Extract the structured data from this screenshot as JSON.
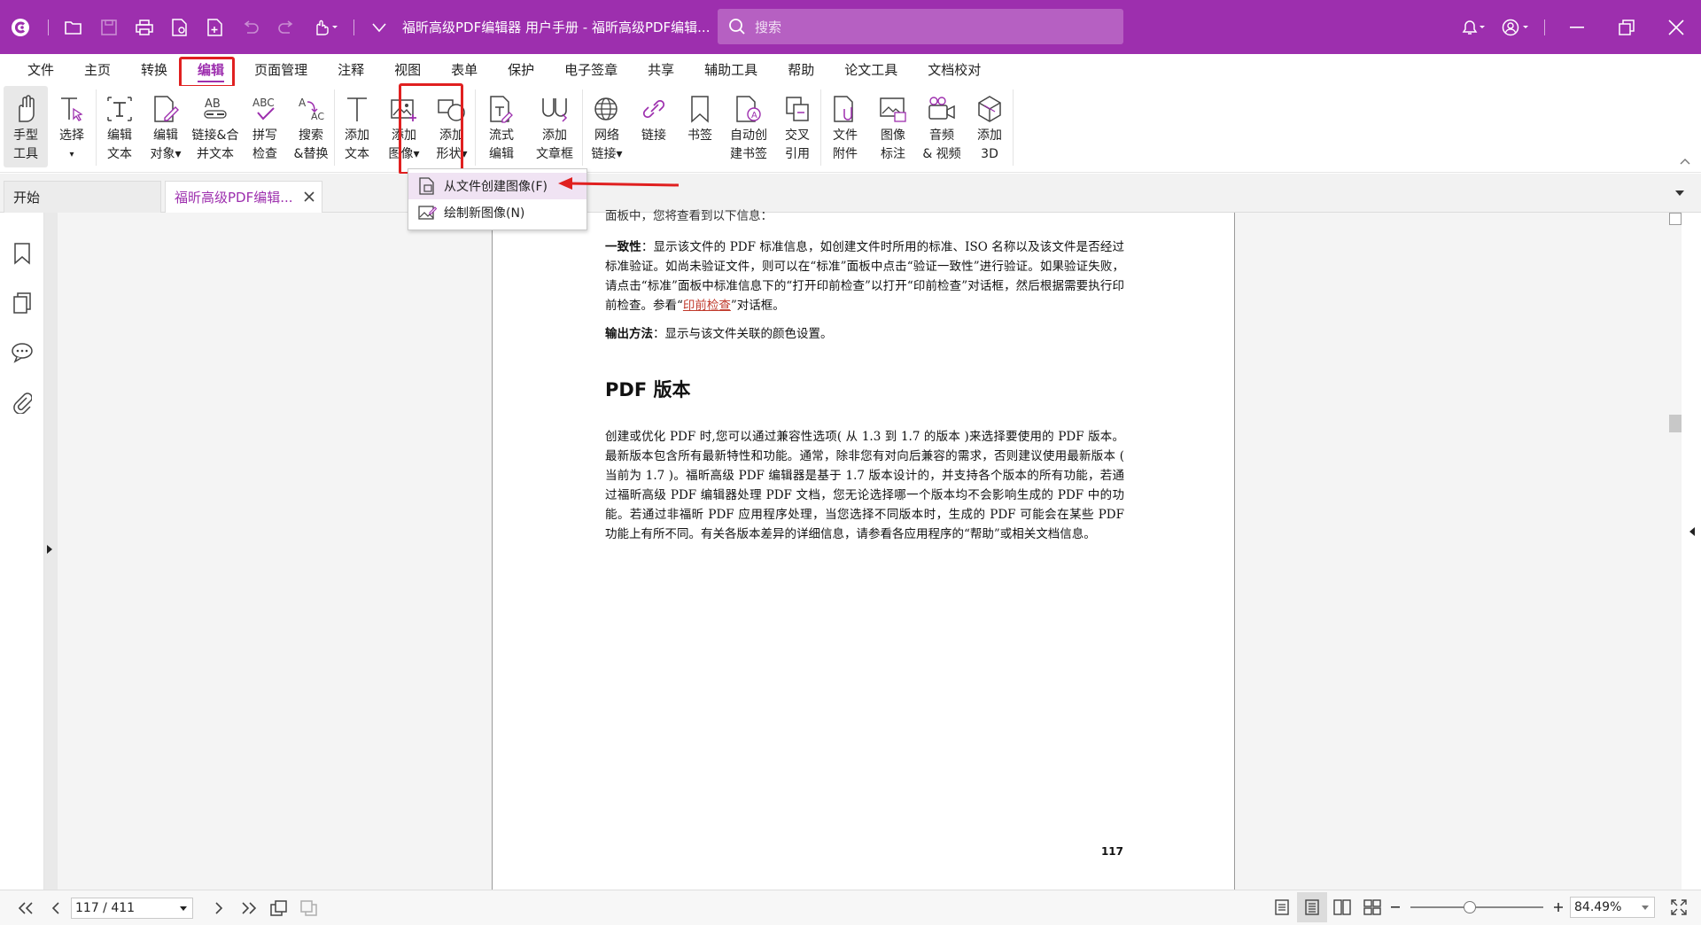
{
  "app": {
    "title": "福昕高级PDF编辑器 用户手册 - 福昕高级PDF编辑...",
    "search_placeholder": "搜索",
    "accent_color": "#9d2fae"
  },
  "menubar": {
    "items": [
      "文件",
      "主页",
      "转换",
      "编辑",
      "页面管理",
      "注释",
      "视图",
      "表单",
      "保护",
      "电子签章",
      "共享",
      "辅助工具",
      "帮助",
      "论文工具",
      "文档校对"
    ],
    "active": "编辑"
  },
  "ribbon": {
    "hand": [
      "手型",
      "工具"
    ],
    "select": [
      "选择",
      "▾"
    ],
    "edit_text": [
      "编辑",
      "文本"
    ],
    "edit_object": [
      "编辑",
      "对象▾"
    ],
    "link_merge": [
      "链接&合",
      "并文本"
    ],
    "spell": [
      "拼写",
      "检查"
    ],
    "search_replace": [
      "搜索",
      "&替换"
    ],
    "add_text": [
      "添加",
      "文本"
    ],
    "add_image": [
      "添加",
      "图像▾"
    ],
    "add_shape": [
      "添加",
      "形状▾"
    ],
    "flow_edit": [
      "流式",
      "编辑"
    ],
    "add_article": [
      "添加",
      "文章框"
    ],
    "web_link": [
      "网络",
      "链接▾"
    ],
    "link": [
      "链接"
    ],
    "bookmark": [
      "书签"
    ],
    "auto_bookmark": [
      "自动创",
      "建书签"
    ],
    "cross_ref": [
      "交叉",
      "引用"
    ],
    "file_attach": [
      "文件",
      "附件"
    ],
    "image_annot": [
      "图像",
      "标注"
    ],
    "audio_video": [
      "音频",
      "& 视频"
    ],
    "add_3d": [
      "添加",
      "3D"
    ]
  },
  "tabs": {
    "start": "开始",
    "doc": "福昕高级PDF编辑..."
  },
  "dropdown": {
    "from_file": "从文件创建图像(F)",
    "draw_new": "绘制新图像(N)"
  },
  "document": {
    "cut_line": "面板中，您将查看到以下信息：",
    "consistency_label": "一致性",
    "consistency_text_1": "：显示该文件的 PDF 标准信息，如创建文件时所用的标准、ISO 名称以及该文件是否经过标准验证。如尚未验证文件，则可以在“标准”面板中点击“验证一致性”进行验证。如果验证失败，请点击“标准”面板中标准信息下的“打开印前检查”以打开“印前检查”对话框，然后根据需要执行印前检查。参看“",
    "consistency_link": "印前检查",
    "consistency_text_2": "”对话框。",
    "output_label": "输出方法",
    "output_text": "：显示与该文件关联的颜色设置。",
    "heading": "PDF 版本",
    "body": "创建或优化 PDF 时,您可以通过兼容性选项( 从 1.3 到 1.7 的版本 )来选择要使用的 PDF 版本。最新版本包含所有最新特性和功能。通常，除非您有对向后兼容的需求，否则建议使用最新版本 ( 当前为 1.7 )。福昕高级 PDF 编辑器是基于 1.7 版本设计的，并支持各个版本的所有功能，若通过福昕高级 PDF 编辑器处理 PDF 文档，您无论选择哪一个版本均不会影响生成的 PDF 中的功能。若通过非福昕 PDF 应用程序处理，当您选择不同版本时，生成的 PDF 可能会在某些 PDF 功能上有所不同。有关各版本差异的详细信息，请参看各应用程序的“帮助”或相关文档信息。",
    "page_number": "117"
  },
  "statusbar": {
    "page_field": "117 / 411",
    "zoom": "84.49%"
  }
}
